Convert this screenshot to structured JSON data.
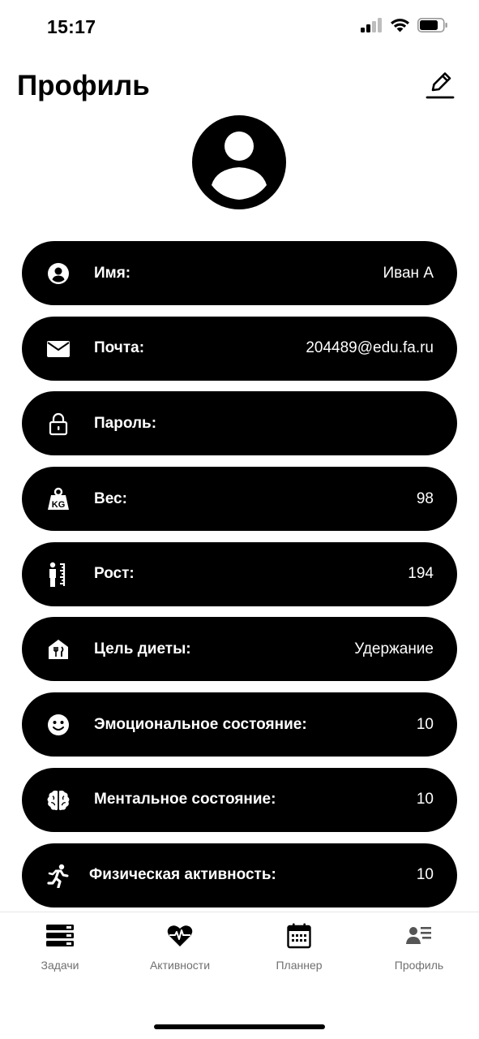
{
  "status_bar": {
    "time": "15:17"
  },
  "header": {
    "title": "Профиль"
  },
  "icons": {
    "edit": "pencil-edit-icon",
    "avatar": "user-avatar-icon"
  },
  "rows": [
    {
      "label": "Имя:",
      "value": "Иван А",
      "icon": "user-circle-icon"
    },
    {
      "label": "Почта:",
      "value": "204489@edu.fa.ru",
      "icon": "mail-icon"
    },
    {
      "label": "Пароль:",
      "value": "",
      "icon": "lock-icon"
    },
    {
      "label": "Вес:",
      "value": "98",
      "icon": "kg-weight-icon"
    },
    {
      "label": "Рост:",
      "value": "194",
      "icon": "height-ruler-icon"
    },
    {
      "label": "Цель диеты:",
      "value": "Удержание",
      "icon": "diet-house-icon"
    },
    {
      "label": "Эмоциональное состояние:",
      "value": "10",
      "icon": "smiley-icon"
    },
    {
      "label": "Ментальное состояние:",
      "value": "10",
      "icon": "brain-icon"
    },
    {
      "label": "Физическая активность:",
      "value": "10",
      "icon": "running-person-icon"
    }
  ],
  "tabbar": {
    "tabs": [
      {
        "label": "Задачи",
        "icon": "tasks-stack-icon"
      },
      {
        "label": "Активности",
        "icon": "heart-pulse-icon"
      },
      {
        "label": "Планнер",
        "icon": "calendar-icon"
      },
      {
        "label": "Профиль",
        "icon": "profile-list-icon"
      }
    ]
  }
}
